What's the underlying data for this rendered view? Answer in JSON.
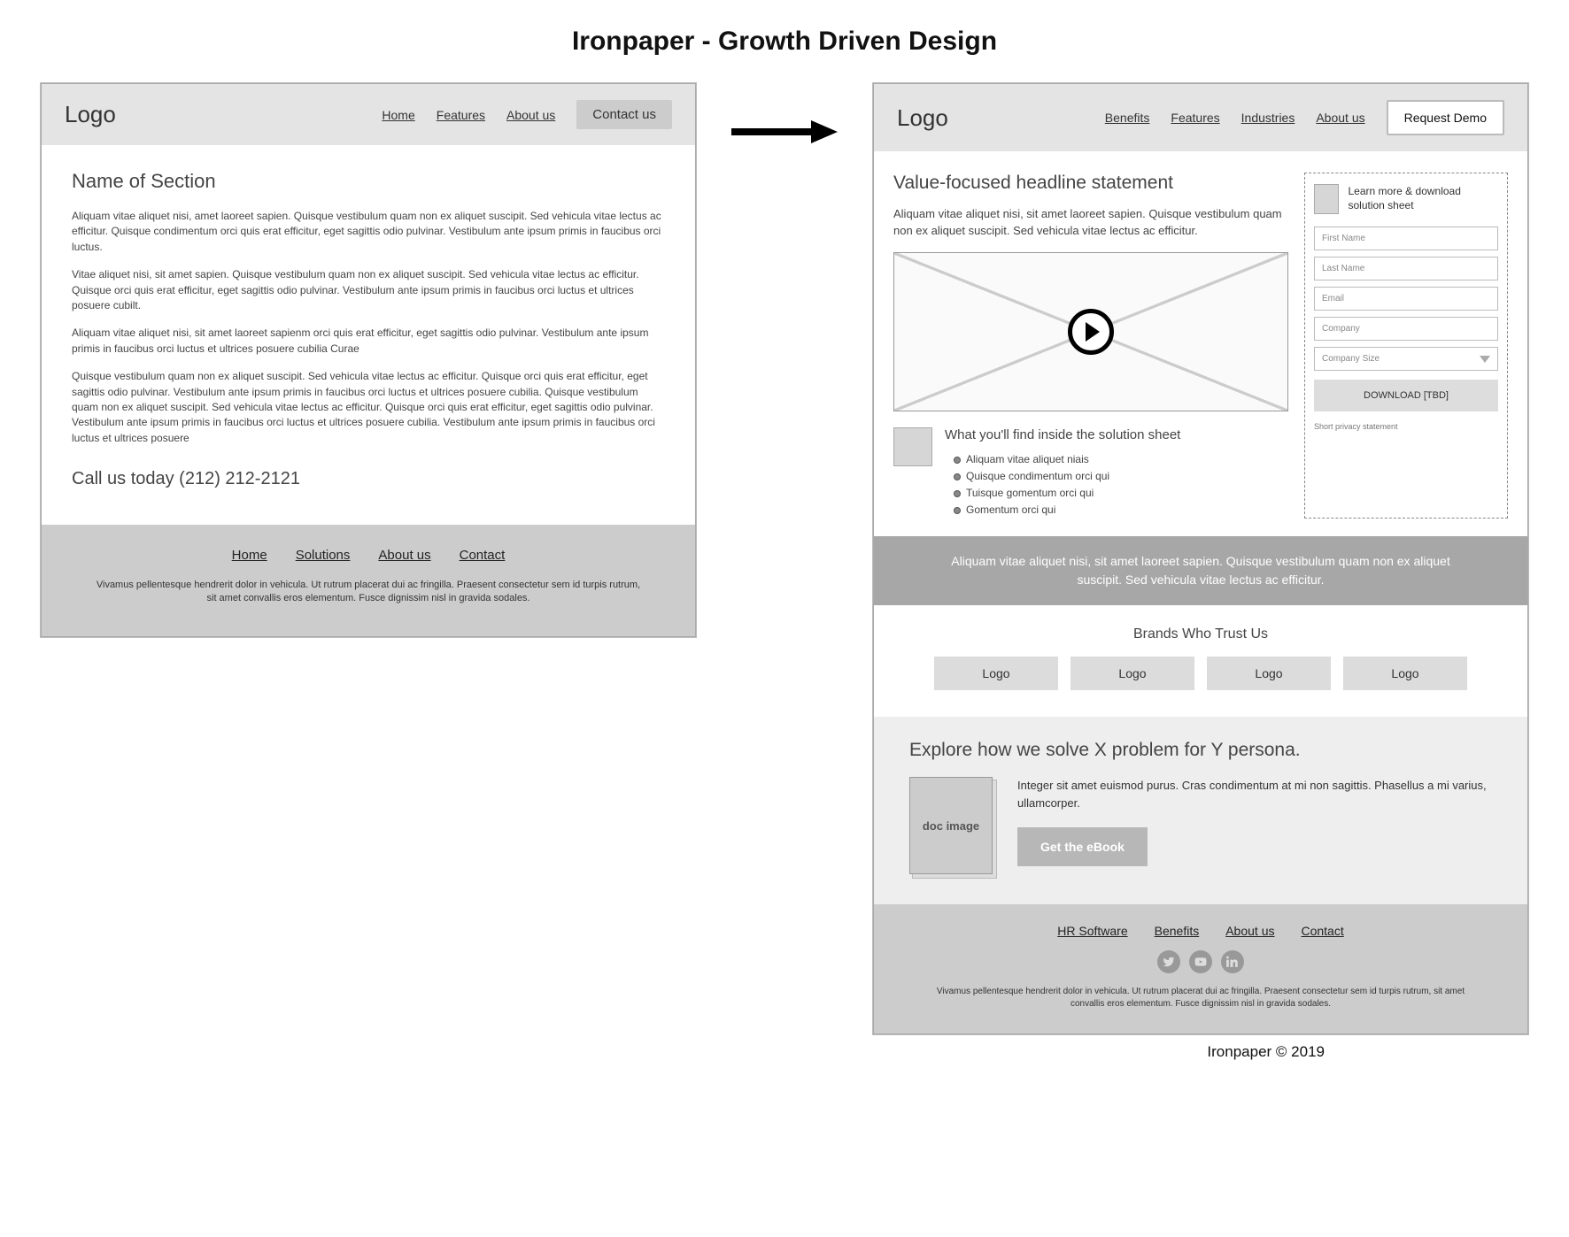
{
  "title_bold": "Ironpaper",
  "title_rest": " - Growth Driven Design",
  "left": {
    "logo": "Logo",
    "nav": [
      "Home",
      "Features",
      "About us"
    ],
    "cta": "Contact us",
    "heading": "Name of Section",
    "paras": [
      "Aliquam vitae aliquet nisi, amet laoreet sapien. Quisque vestibulum quam non ex aliquet suscipit. Sed vehicula vitae lectus ac efficitur. Quisque condimentum orci quis erat efficitur, eget sagittis odio pulvinar. Vestibulum ante ipsum primis in faucibus orci luctus.",
      "Vitae aliquet nisi, sit amet sapien. Quisque vestibulum quam non ex aliquet suscipit. Sed vehicula vitae lectus ac efficitur. Quisque orci quis erat efficitur, eget sagittis odio pulvinar. Vestibulum ante ipsum primis in faucibus orci luctus et ultrices posuere cubilt.",
      "Aliquam vitae aliquet nisi, sit amet laoreet sapienm orci quis erat efficitur, eget sagittis odio pulvinar. Vestibulum ante ipsum primis in faucibus orci luctus et ultrices posuere cubilia Curae",
      "Quisque vestibulum quam non ex aliquet suscipit. Sed vehicula vitae lectus ac efficitur. Quisque orci quis erat efficitur, eget sagittis odio pulvinar. Vestibulum ante ipsum primis in faucibus orci luctus et ultrices posuere cubilia. Quisque vestibulum quam non ex aliquet suscipit. Sed vehicula vitae lectus ac efficitur. Quisque orci quis erat efficitur, eget sagittis odio pulvinar. Vestibulum ante ipsum primis in faucibus orci luctus et ultrices posuere cubilia. Vestibulum ante ipsum primis in faucibus orci luctus et ultrices posuere"
    ],
    "call": "Call us today (212) 212-2121",
    "footer_links": [
      "Home",
      "Solutions",
      "About us",
      "Contact"
    ],
    "footer_text": "Vivamus pellentesque hendrerit dolor in vehicula. Ut rutrum placerat dui ac fringilla. Praesent consectetur sem id turpis rutrum, sit amet convallis eros elementum. Fusce dignissim nisl in gravida sodales."
  },
  "right": {
    "logo": "Logo",
    "nav": [
      "Benefits",
      "Features",
      "Industries",
      "About us"
    ],
    "cta": "Request Demo",
    "heading": "Value-focused headline statement",
    "para": "Aliquam vitae aliquet nisi, sit amet laoreet sapien. Quisque vestibulum quam non ex aliquet suscipit. Sed vehicula vitae lectus ac efficitur.",
    "inside_heading": "What you'll find inside the solution sheet",
    "inside_items": [
      "Aliquam vitae aliquet niais",
      "Quisque condimentum orci qui",
      "Tuisque gomentum orci qui",
      "Gomentum orci qui"
    ],
    "form": {
      "lead": "Learn more & download solution sheet",
      "fields": [
        "First Name",
        "Last Name",
        "Email",
        "Company"
      ],
      "select": "Company Size",
      "button": "DOWNLOAD [TBD]",
      "privacy": "Short privacy statement"
    },
    "banner": "Aliquam vitae aliquet nisi, sit amet laoreet sapien. Quisque vestibulum quam non ex aliquet suscipit. Sed vehicula vitae lectus ac efficitur.",
    "brands_heading": "Brands Who Trust Us",
    "brands": [
      "Logo",
      "Logo",
      "Logo",
      "Logo"
    ],
    "explore_heading": "Explore how we solve X problem for Y persona.",
    "doc_label": "doc image",
    "explore_text": "Integer sit amet euismod purus. Cras condimentum at mi non sagittis. Phasellus a mi varius, ullamcorper.",
    "ebook_btn": "Get the eBook",
    "footer_links": [
      "HR Software",
      "Benefits",
      "About us",
      "Contact"
    ],
    "socials": [
      "twitter",
      "youtube",
      "linkedin"
    ],
    "footer_text": "Vivamus pellentesque hendrerit dolor in vehicula. Ut rutrum placerat dui ac fringilla. Praesent consectetur sem id turpis rutrum, sit amet convallis eros elementum. Fusce dignissim nisl in gravida sodales."
  },
  "copyright": "Ironpaper © 2019"
}
